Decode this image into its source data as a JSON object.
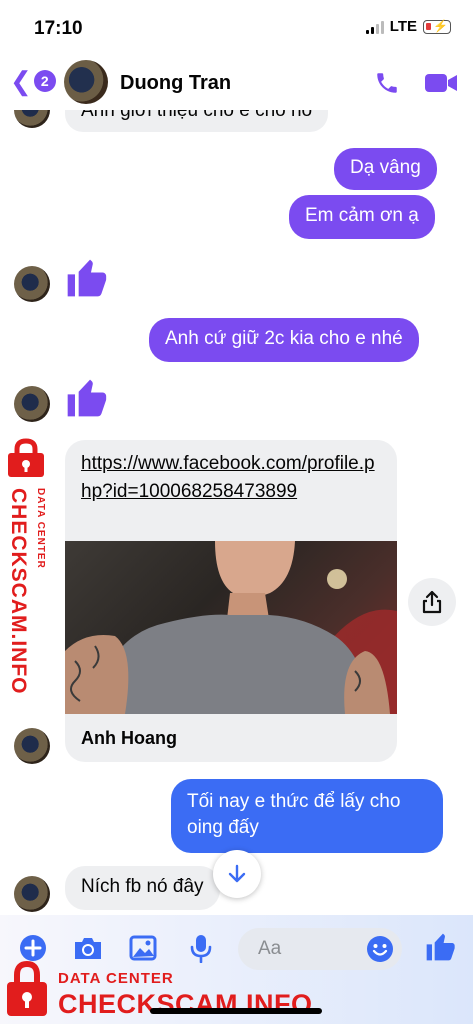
{
  "status_bar": {
    "time": "17:10",
    "network": "LTE"
  },
  "header": {
    "back_badge": "2",
    "contact_name": "Duong Tran"
  },
  "messages": {
    "m0_partial": "Anh giới thiệu cho e cho nó",
    "m1": "Dạ vâng",
    "m2": "Em cảm ơn ạ",
    "m3": "Anh cứ giữ 2c kia cho e nhé",
    "link_url": "https://www.facebook.com/profile.php?id=100068258473899",
    "link_title": "Anh Hoang",
    "m4": "Tối nay e thức để lấy cho oing đấy",
    "m5": "Ních fb nó đây"
  },
  "composer": {
    "placeholder": "Aa"
  },
  "watermark": {
    "sub": "DATA CENTER",
    "main": "CHECKSCAM.INFO"
  },
  "colors": {
    "accent": "#7b4bf0",
    "blue_bubble": "#3b6cf4",
    "watermark": "#e11d1d"
  }
}
